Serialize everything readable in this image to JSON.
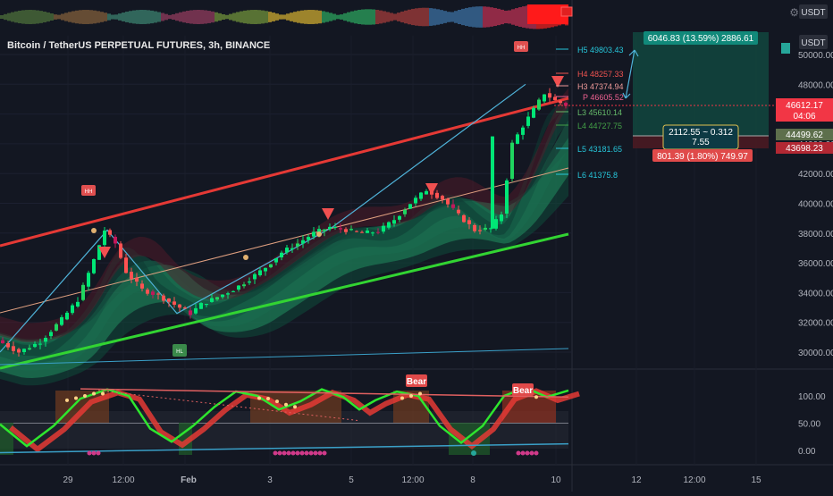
{
  "header": {
    "title": "Bitcoin / TetherUS PERPETUAL FUTURES, 3h, BINANCE",
    "top_currency": "USDT",
    "main_currency": "USDT"
  },
  "price_axis": {
    "ticks": [
      "50000.00",
      "48000.00",
      "46000.00",
      "44000.00",
      "42000.00",
      "40000.00",
      "38000.00",
      "36000.00",
      "34000.00",
      "32000.00",
      "30000.00"
    ],
    "markers": [
      {
        "label": "46612.17",
        "sub": "04:06",
        "color": "#f23645"
      },
      {
        "label": "44499.62",
        "color": "#5d6f4c"
      },
      {
        "label": "43698.23",
        "color": "#b22833"
      }
    ]
  },
  "oscillator_axis": {
    "ticks": [
      "100.00",
      "50.00",
      "0.00"
    ]
  },
  "time_axis": {
    "ticks": [
      "29",
      "12:00",
      "Feb",
      "3",
      "5",
      "12:00",
      "8",
      "10",
      "12",
      "12:00",
      "15"
    ]
  },
  "pivots": [
    {
      "label": "H5 49803.43",
      "color": "#26c6da"
    },
    {
      "label": "H4 48257.33",
      "color": "#ef5350"
    },
    {
      "label": "H3 47374.94",
      "color": "#ef9a9a"
    },
    {
      "label": "P 46605.52",
      "color": "#f06292"
    },
    {
      "label": "L3 45610.14",
      "color": "#66bb6a"
    },
    {
      "label": "L4 44727.75",
      "color": "#43a047"
    },
    {
      "label": "L5 43181.65",
      "color": "#26c6da"
    },
    {
      "label": "L6 41375.8",
      "color": "#26c6da"
    }
  ],
  "position_tool": {
    "target": "6046.83 (13.59%) 2886.61",
    "center_line1": "2112.55 ~ 0.312",
    "center_line2": "7.55",
    "stop": "801.39 (1.80%) 749.97"
  },
  "oscillator_labels": [
    "Bear",
    "Bear"
  ],
  "signal_labels": {
    "hh": "HH",
    "hl": "HL"
  },
  "colors": {
    "background": "#131722",
    "up": "#00e676",
    "down": "#ff5252",
    "channel_upper": "#e53935",
    "channel_lower": "#32d432",
    "zigzag": "#4fb3d9",
    "regression": "#e0a080"
  },
  "chart_data": {
    "type": "candlestick",
    "title": "Bitcoin / TetherUS PERPETUAL FUTURES, 3h, BINANCE",
    "x_ticks": [
      "29",
      "12:00",
      "Feb",
      "3",
      "5",
      "12:00",
      "8",
      "10",
      "12",
      "12:00",
      "15"
    ],
    "ylim": [
      29000,
      51000
    ],
    "y_ticks": [
      50000,
      48000,
      46000,
      44000,
      42000,
      40000,
      38000,
      36000,
      34000,
      32000,
      30000
    ],
    "close_path": [
      [
        0,
        30800
      ],
      [
        4,
        30000
      ],
      [
        8,
        30700
      ],
      [
        12,
        32200
      ],
      [
        15,
        33500
      ],
      [
        18,
        36200
      ],
      [
        20,
        38200
      ],
      [
        22,
        37300
      ],
      [
        24,
        35400
      ],
      [
        27,
        34200
      ],
      [
        30,
        33800
      ],
      [
        33,
        33200
      ],
      [
        36,
        32600
      ],
      [
        38,
        33200
      ],
      [
        41,
        33700
      ],
      [
        44,
        34200
      ],
      [
        47,
        34900
      ],
      [
        50,
        35700
      ],
      [
        53,
        36700
      ],
      [
        56,
        37300
      ],
      [
        59,
        38000
      ],
      [
        62,
        38400
      ],
      [
        65,
        38200
      ],
      [
        68,
        38000
      ],
      [
        71,
        38100
      ],
      [
        74,
        38900
      ],
      [
        77,
        40000
      ],
      [
        80,
        40900
      ],
      [
        83,
        40300
      ],
      [
        86,
        39200
      ],
      [
        89,
        38200
      ],
      [
        92,
        38300
      ],
      [
        94,
        39300
      ],
      [
        96,
        44000
      ],
      [
        98,
        45200
      ],
      [
        100,
        46300
      ],
      [
        102,
        47400
      ],
      [
        104,
        46900
      ],
      [
        106,
        46612
      ]
    ],
    "last_price": 46612.17,
    "oscillator": {
      "ylim": [
        -10,
        125
      ],
      "ticks": [
        100,
        50,
        0
      ],
      "path": [
        [
          0,
          48
        ],
        [
          5,
          8
        ],
        [
          10,
          45
        ],
        [
          15,
          95
        ],
        [
          20,
          112
        ],
        [
          24,
          100
        ],
        [
          28,
          40
        ],
        [
          32,
          16
        ],
        [
          36,
          45
        ],
        [
          40,
          80
        ],
        [
          44,
          108
        ],
        [
          48,
          100
        ],
        [
          52,
          75
        ],
        [
          56,
          90
        ],
        [
          60,
          112
        ],
        [
          64,
          98
        ],
        [
          67,
          75
        ],
        [
          70,
          92
        ],
        [
          74,
          108
        ],
        [
          78,
          100
        ],
        [
          82,
          45
        ],
        [
          86,
          14
        ],
        [
          90,
          45
        ],
        [
          94,
          100
        ],
        [
          98,
          115
        ],
        [
          102,
          98
        ],
        [
          106,
          110
        ]
      ]
    }
  }
}
